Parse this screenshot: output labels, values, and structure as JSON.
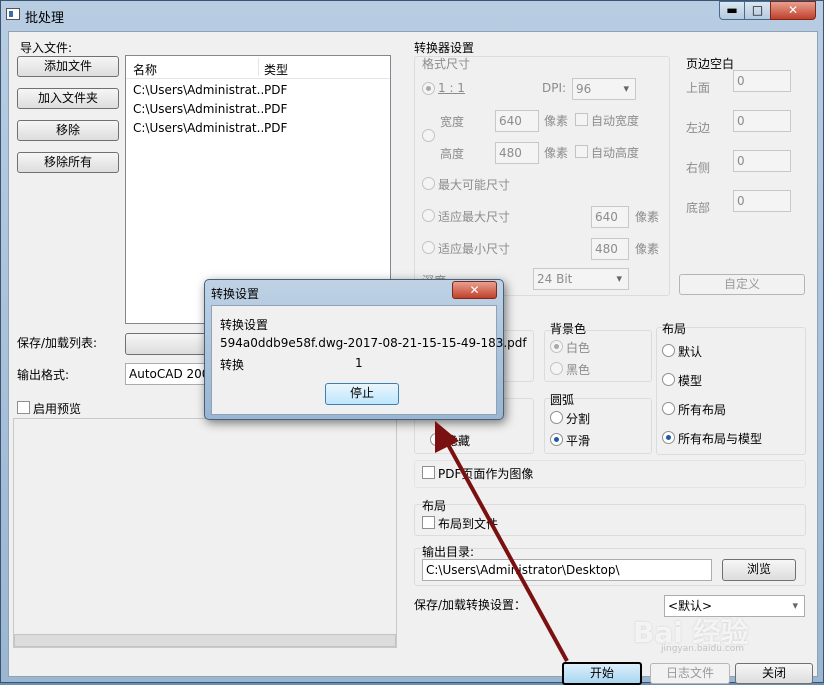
{
  "window": {
    "title": "批处理",
    "minimize": "▬",
    "maximize": "□",
    "close": "✕"
  },
  "left": {
    "import_label": "导入文件:",
    "buttons": {
      "add_file": "添加文件",
      "add_folder": "加入文件夹",
      "remove": "移除",
      "remove_all": "移除所有"
    },
    "columns": [
      "名称",
      "类型"
    ],
    "files": [
      {
        "name": "C:\\Users\\Administrat...",
        "type": "PDF"
      },
      {
        "name": "C:\\Users\\Administrat...",
        "type": "PDF"
      },
      {
        "name": "C:\\Users\\Administrat...",
        "type": "PDF"
      }
    ],
    "save_load_list_label": "保存/加载列表:",
    "output_format_label": "输出格式:",
    "output_format_value": "AutoCAD 2000",
    "preview_label": "启用预览"
  },
  "converter": {
    "section_label": "转换器设置",
    "format_size_label": "格式尺寸",
    "ratio_label": "1 : 1",
    "dpi_label": "DPI:",
    "dpi_value": "96",
    "width_label": "宽度",
    "width_value": "640",
    "height_label": "高度",
    "height_value": "480",
    "pixel_unit": "像素",
    "auto_width": "自动宽度",
    "auto_height": "自动高度",
    "max_possible": "最大可能尺寸",
    "fit_max": "适应最大尺寸",
    "fit_max_value": "640",
    "fit_min": "适应最小尺寸",
    "fit_min_value": "480",
    "depth_label": "深度",
    "depth_value": "24 Bit",
    "margins_label": "页边空白",
    "margin_top": "上面",
    "margin_left": "左边",
    "margin_right": "右侧",
    "margin_bottom": "底部",
    "margin_values": [
      "0",
      "0",
      "0",
      "0"
    ],
    "custom_button": "自定义",
    "background_label": "背景色",
    "bg_white": "白色",
    "bg_black": "黑色",
    "layout_label": "布局",
    "layout_default": "默认",
    "layout_model": "模型",
    "layout_all": "所有布局",
    "layout_all_model": "所有布局与模型",
    "arc_label": "圆弧",
    "arc_split": "分割",
    "arc_smooth": "平滑",
    "hide_label": "隐藏",
    "pdf_page_image": "PDF页面作为图像",
    "layout2_label": "布局",
    "layout_to_file": "布局到文件",
    "output_dir_label": "输出目录:",
    "output_dir_value": "C:\\Users\\Administrator\\Desktop\\",
    "browse_button": "浏览",
    "save_load_settings_label": "保存/加载转换设置：",
    "settings_value": "<默认>"
  },
  "bottom_buttons": {
    "start": "开始",
    "log": "日志文件",
    "close": "关闭"
  },
  "dialog": {
    "title": "转换设置",
    "close": "✕",
    "heading": "转换设置",
    "filename": "594a0ddb9e58f.dwg-2017-08-21-15-15-49-183.pdf",
    "convert_label": "转换",
    "convert_count": "1",
    "stop_button": "停止"
  },
  "watermark": {
    "brand": "Bai 经验",
    "sub": "jingyan.baidu.com"
  },
  "colors": {
    "arrow": "#7a1010",
    "accent": "#1e5aa8",
    "titlebar": "#9bb6d1"
  }
}
